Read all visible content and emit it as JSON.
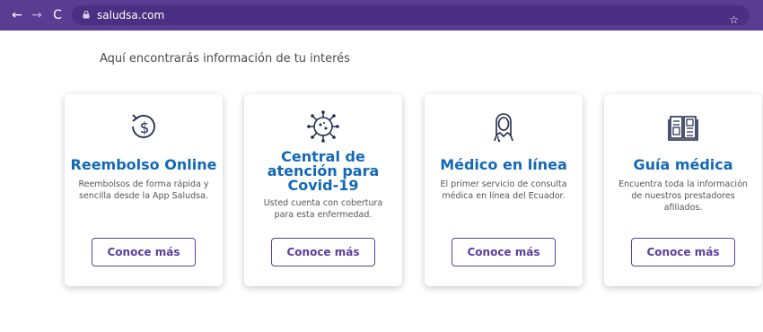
{
  "browser": {
    "url": "saludsa.com",
    "back_icon": "←",
    "forward_icon": "→",
    "reload_icon": "C",
    "star_icon": "☆"
  },
  "page": {
    "heading": "Aquí encontrarás información de tu interés"
  },
  "colors": {
    "browser_bar": "#5a3c93",
    "title_blue": "#1368b8",
    "button_purple": "#5b3ea1"
  },
  "cards": [
    {
      "icon": "dollar-refresh-icon",
      "title": "Reembolso Online",
      "description": "Reembolsos de forma rápida y sencilla desde la App Saludsa.",
      "button_label": "Conoce más"
    },
    {
      "icon": "virus-icon",
      "title": "Central de atención para Covid-19",
      "description": "Usted cuenta con cobertura para esta enfermedad.",
      "button_label": "Conoce más"
    },
    {
      "icon": "doctor-icon",
      "title": "Médico en línea",
      "description": "El primer servicio de consulta médica en línea del Ecuador.",
      "button_label": "Conoce más"
    },
    {
      "icon": "book-icon",
      "title": "Guía médica",
      "description": "Encuentra toda la información de nuestros prestadores afiliados.",
      "button_label": "Conoce más"
    }
  ]
}
